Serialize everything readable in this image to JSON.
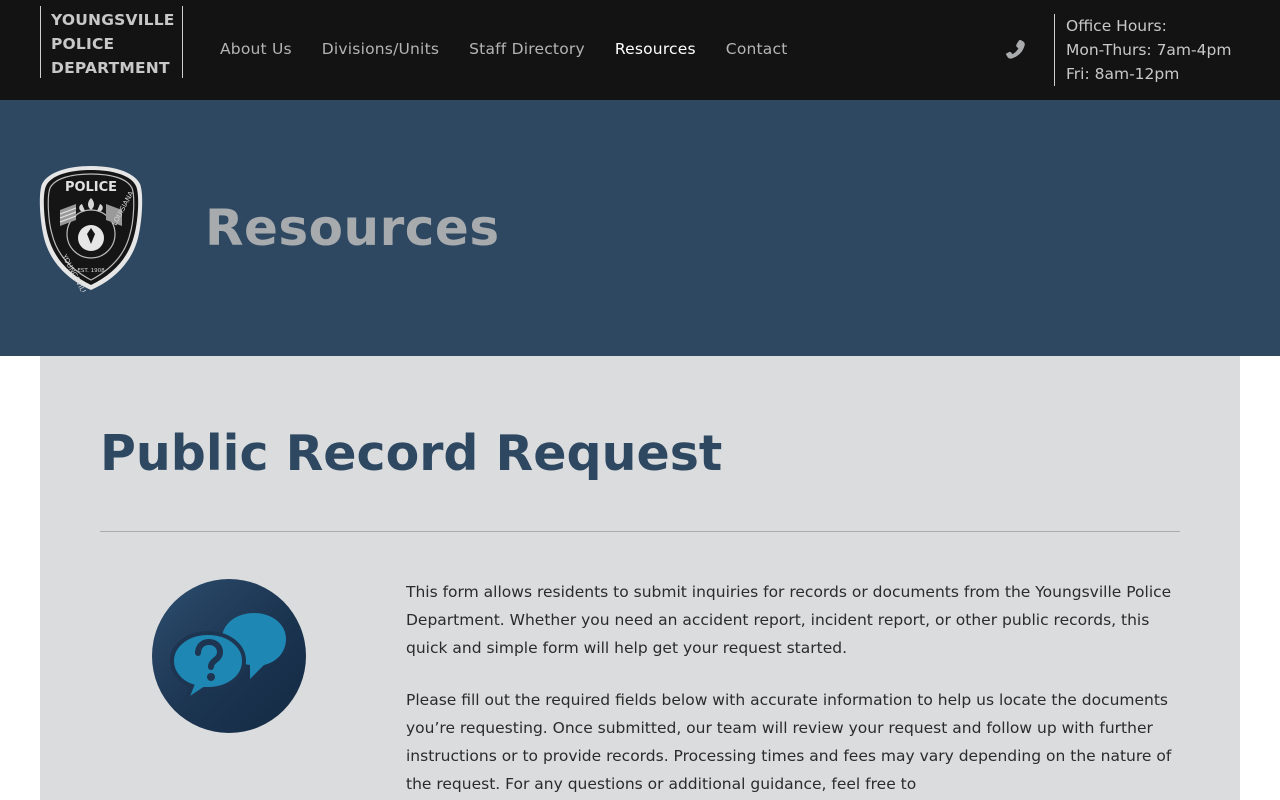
{
  "header": {
    "brand_lines": [
      "YOUNGSVILLE",
      "POLICE",
      "DEPARTMENT"
    ],
    "nav": [
      {
        "label": "About Us",
        "active": false
      },
      {
        "label": "Divisions/Units",
        "active": false
      },
      {
        "label": "Staff Directory",
        "active": false
      },
      {
        "label": "Resources",
        "active": true
      },
      {
        "label": "Contact",
        "active": false
      }
    ],
    "phone_icon": "phone-icon",
    "hours": [
      "Office Hours:",
      "Mon-Thurs: 7am-4pm",
      "Fri: 8am-12pm"
    ]
  },
  "hero": {
    "title": "Resources",
    "badge": {
      "top_text": "POLICE",
      "left_text": "YOUNGSVILLE",
      "right_text": "LOUISIANA",
      "est_text": "EST. 1908"
    }
  },
  "main": {
    "title": "Public Record Request",
    "icon": "chat-question-icon",
    "paragraphs": [
      "This form allows residents to submit inquiries for records or documents from the Youngsville Police Department. Whether you need an accident report, incident report, or other public records, this quick and simple form will help get your request started.",
      "Please fill out the required fields below with accurate information to help us locate the documents you’re requesting. Once submitted, our team will review your request and follow up with further instructions or to provide records. Processing times and fees may vary depending on the nature of the request. For any questions or additional guidance, feel free to"
    ]
  },
  "colors": {
    "header_bg": "#131313",
    "hero_bg": "#2f4862",
    "content_bg": "#dadcdd",
    "accent": "#2f4862",
    "icon_blue": "#1f87b3"
  }
}
